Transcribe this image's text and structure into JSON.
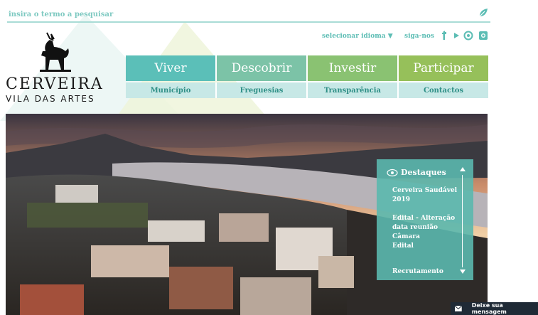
{
  "search": {
    "placeholder": "insira o termo a pesquisar",
    "icon": "leaf-search-icon"
  },
  "logo": {
    "title": "CERVEIRA",
    "subtitle": "VILA DAS ARTES"
  },
  "topbar": {
    "language_label": "selecionar idioma ▼",
    "follow_label": "siga-nos"
  },
  "social": [
    "facebook-icon",
    "youtube-icon",
    "flickr-icon",
    "instagram-icon"
  ],
  "main_nav": [
    {
      "label": "Viver",
      "color": "#5bbfb8"
    },
    {
      "label": "Descobrir",
      "color": "#7cc3a7"
    },
    {
      "label": "Investir",
      "color": "#8ac272"
    },
    {
      "label": "Participar",
      "color": "#96c05a"
    }
  ],
  "sub_nav": [
    {
      "label": "Município"
    },
    {
      "label": "Freguesias"
    },
    {
      "label": "Transparência"
    },
    {
      "label": "Contactos"
    }
  ],
  "highlights": {
    "title": "Destaques",
    "items": [
      "Cerveira Saudável 2019",
      "Edital - Alteração data reunião Câmara",
      "Edital",
      "Recrutamento"
    ]
  },
  "message_bar": {
    "label": "Deixe sua mensagem"
  },
  "colors": {
    "accent": "#5cbdb4",
    "dark": "#1a1a1a",
    "panel": "#5bb8ae"
  }
}
